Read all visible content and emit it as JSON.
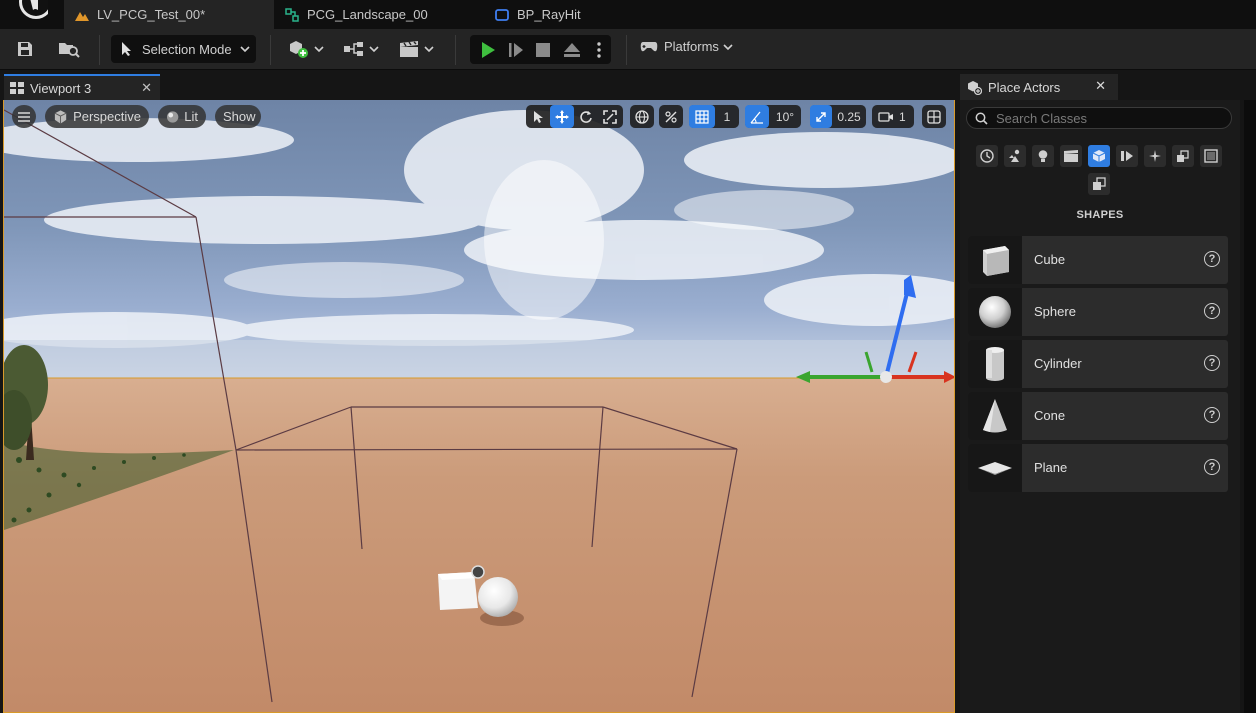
{
  "tabs": [
    {
      "label": "LV_PCG_Test_00*",
      "icon": "level-icon",
      "active": true
    },
    {
      "label": "PCG_Landscape_00",
      "icon": "pcg-graph-icon",
      "active": false
    },
    {
      "label": "BP_RayHit",
      "icon": "blueprint-icon",
      "active": false
    }
  ],
  "toolbar": {
    "selection_mode": "Selection Mode",
    "platforms": "Platforms"
  },
  "viewport": {
    "tab_label": "Viewport 3",
    "perspective": "Perspective",
    "lit": "Lit",
    "show": "Show",
    "grid_snap": "1",
    "rotation_snap": "10°",
    "scale_snap": "0.25",
    "camera_speed": "1"
  },
  "place_actors": {
    "tab_label": "Place Actors",
    "search_placeholder": "Search Classes",
    "section": "SHAPES",
    "items": [
      {
        "label": "Cube",
        "icon": "cube-icon"
      },
      {
        "label": "Sphere",
        "icon": "sphere-icon"
      },
      {
        "label": "Cylinder",
        "icon": "cylinder-icon"
      },
      {
        "label": "Cone",
        "icon": "cone-icon"
      },
      {
        "label": "Plane",
        "icon": "plane-icon"
      }
    ]
  },
  "colors": {
    "accent": "#2f7de1",
    "viewport_border": "#d89a2a",
    "play_green": "#3fbf3f"
  }
}
